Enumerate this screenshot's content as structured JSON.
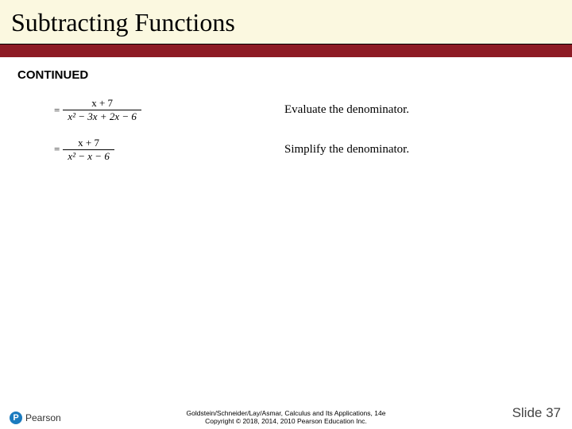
{
  "title": "Subtracting Functions",
  "continued_label": "CONTINUED",
  "rows": [
    {
      "numerator": "x + 7",
      "denominator": "x² − 3x + 2x − 6",
      "annotation": "Evaluate the denominator."
    },
    {
      "numerator": "x + 7",
      "denominator": "x² − x − 6",
      "annotation": "Simplify the denominator."
    }
  ],
  "footer": {
    "brand_letter": "P",
    "brand_text": "Pearson",
    "credit_line1": "Goldstein/Schneider/Lay/Asmar, Calculus and Its Applications, 14e",
    "credit_line2": "Copyright © 2018, 2014, 2010 Pearson Education Inc.",
    "slide_label": "Slide 37"
  }
}
